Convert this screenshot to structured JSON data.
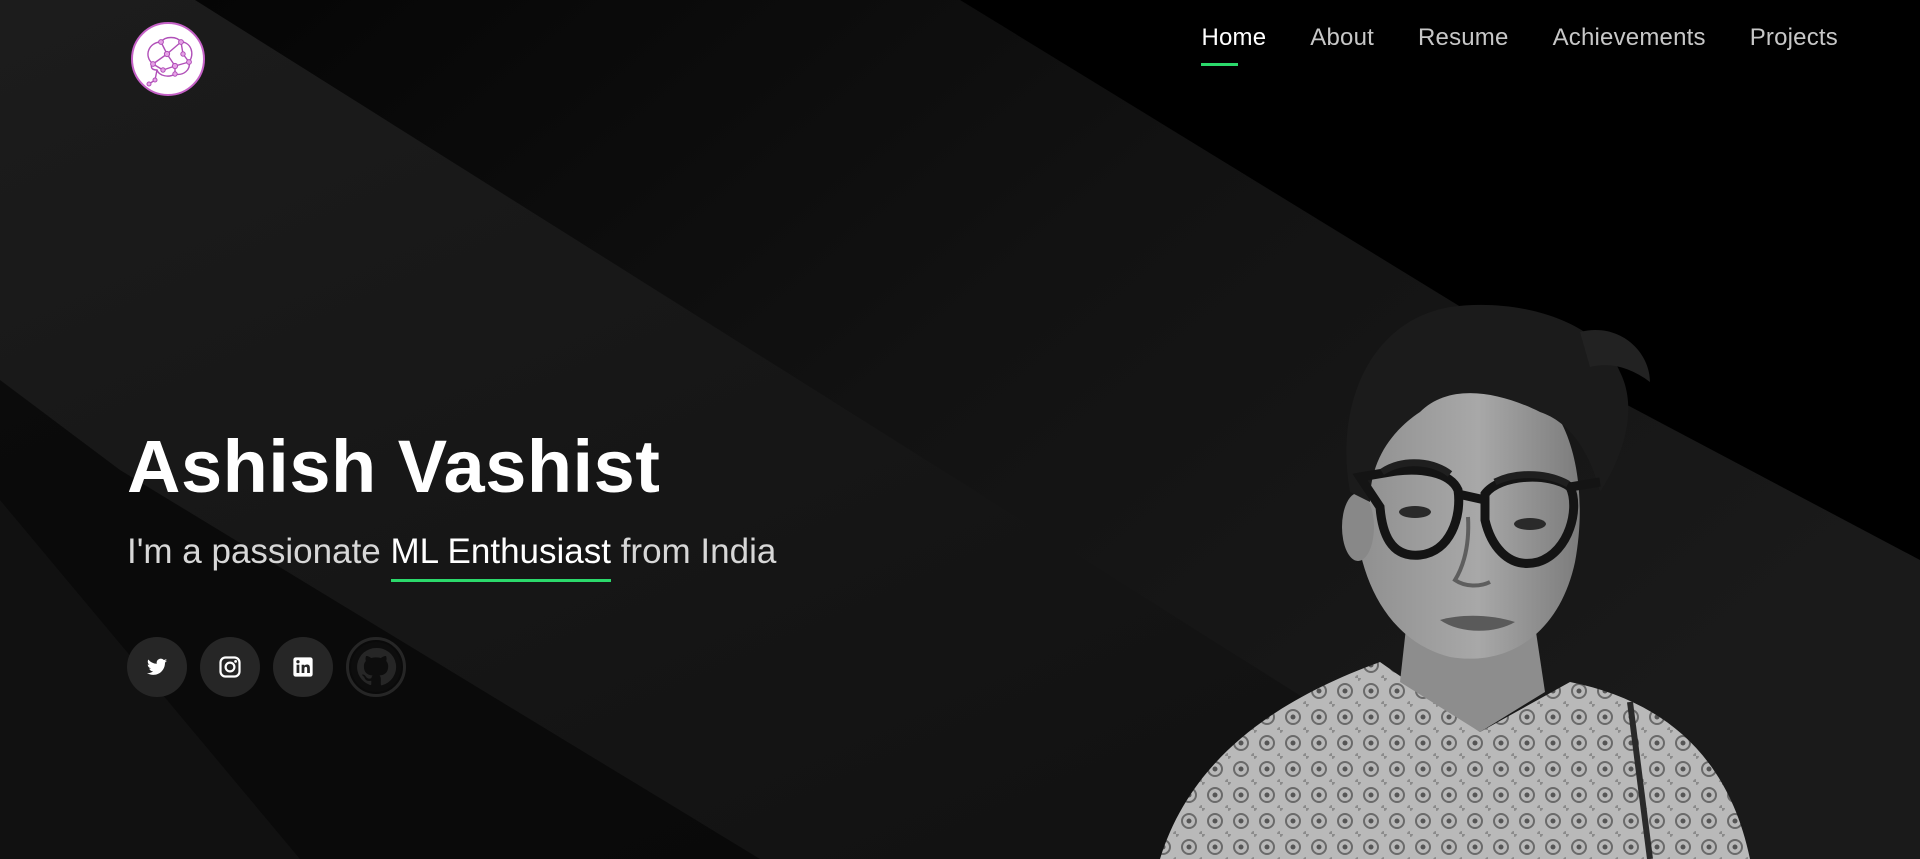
{
  "brand": {
    "logo_icon": "brain-network-icon",
    "accent": "#2bd96b",
    "logo_color": "#c561c7"
  },
  "nav": {
    "items": [
      {
        "label": "Home",
        "active": true
      },
      {
        "label": "About"
      },
      {
        "label": "Resume"
      },
      {
        "label": "Achievements"
      },
      {
        "label": "Projects"
      }
    ]
  },
  "hero": {
    "name": "Ashish Vashist",
    "tagline_prefix": "I'm a passionate ",
    "tagline_highlight": "ML Enthusiast",
    "tagline_suffix": " from India"
  },
  "socials": [
    {
      "icon": "twitter-icon"
    },
    {
      "icon": "instagram-icon"
    },
    {
      "icon": "linkedin-icon"
    },
    {
      "icon": "github-icon"
    }
  ]
}
